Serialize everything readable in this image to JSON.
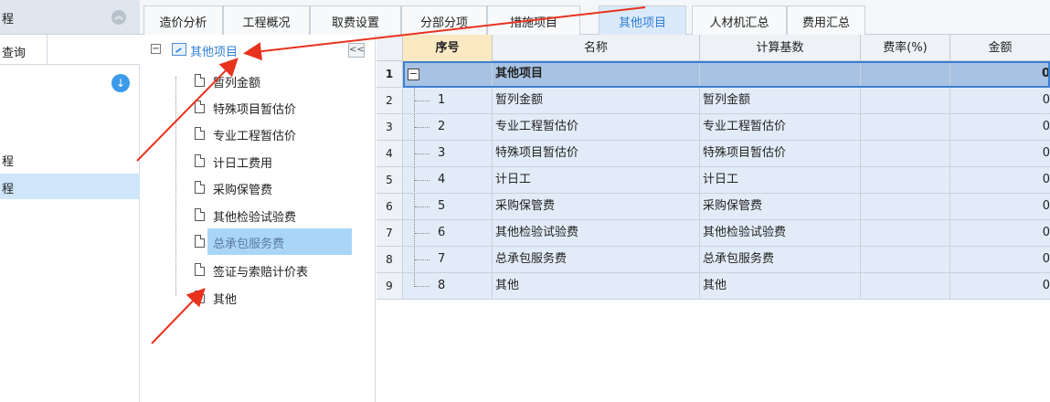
{
  "left_panel": {
    "header_label": "程",
    "query_tab": "查询",
    "items": [
      "程",
      "程"
    ]
  },
  "tabs": [
    {
      "label": "造价分析",
      "active": false
    },
    {
      "label": "工程概况",
      "active": false
    },
    {
      "label": "取费设置",
      "active": false
    },
    {
      "label": "分部分项",
      "active": false
    },
    {
      "label": "措施项目",
      "active": false
    },
    {
      "label": "其他项目",
      "active": true
    },
    {
      "label": "人材机汇总",
      "active": false
    },
    {
      "label": "费用汇总",
      "active": false
    }
  ],
  "tree": {
    "root_label": "其他项目",
    "collapse_label": "<<",
    "items": [
      {
        "label": "暂列金额",
        "selected": false
      },
      {
        "label": "特殊项目暂估价",
        "selected": false
      },
      {
        "label": "专业工程暂估价",
        "selected": false
      },
      {
        "label": "计日工费用",
        "selected": false
      },
      {
        "label": "采购保管费",
        "selected": false
      },
      {
        "label": "其他检验试验费",
        "selected": false
      },
      {
        "label": "总承包服务费",
        "selected": true
      },
      {
        "label": "签证与索赔计价表",
        "selected": false
      },
      {
        "label": "其他",
        "selected": false
      }
    ]
  },
  "grid": {
    "columns": [
      "序号",
      "名称",
      "计算基数",
      "费率(%)",
      "金额"
    ],
    "rows": [
      {
        "num": "1",
        "seq": "",
        "name": "其他项目",
        "base": "",
        "rate": "",
        "amount": "0"
      },
      {
        "num": "2",
        "seq": "1",
        "name": "暂列金额",
        "base": "暂列金额",
        "rate": "",
        "amount": "0"
      },
      {
        "num": "3",
        "seq": "2",
        "name": "专业工程暂估价",
        "base": "专业工程暂估价",
        "rate": "",
        "amount": "0"
      },
      {
        "num": "4",
        "seq": "3",
        "name": "特殊项目暂估价",
        "base": "特殊项目暂估价",
        "rate": "",
        "amount": "0"
      },
      {
        "num": "5",
        "seq": "4",
        "name": "计日工",
        "base": "计日工",
        "rate": "",
        "amount": "0"
      },
      {
        "num": "6",
        "seq": "5",
        "name": "采购保管费",
        "base": "采购保管费",
        "rate": "",
        "amount": "0"
      },
      {
        "num": "7",
        "seq": "6",
        "name": "其他检验试验费",
        "base": "其他检验试验费",
        "rate": "",
        "amount": "0"
      },
      {
        "num": "8",
        "seq": "7",
        "name": "总承包服务费",
        "base": "总承包服务费",
        "rate": "",
        "amount": "0"
      },
      {
        "num": "9",
        "seq": "8",
        "name": "其他",
        "base": "其他",
        "rate": "",
        "amount": "0"
      }
    ]
  },
  "colors": {
    "accent": "#2f7fd6",
    "annotation_arrow": "#e8321e",
    "selected_row": "#a7c2e2"
  }
}
